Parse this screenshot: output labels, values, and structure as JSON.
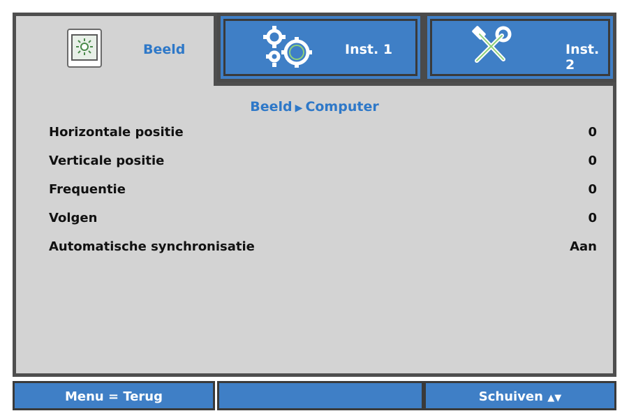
{
  "tabs": [
    {
      "label": "Beeld",
      "icon": "picture-icon",
      "active": true
    },
    {
      "label": "Inst. 1",
      "icon": "gears-icon",
      "active": false
    },
    {
      "label": "Inst. 2",
      "icon": "tools-icon",
      "active": false
    }
  ],
  "breadcrumb": {
    "parent": "Beeld",
    "separator": "▶",
    "current": "Computer"
  },
  "rows": [
    {
      "label": "Horizontale positie",
      "value": "0"
    },
    {
      "label": "Verticale positie",
      "value": "0"
    },
    {
      "label": "Frequentie",
      "value": "0"
    },
    {
      "label": "Volgen",
      "value": "0"
    },
    {
      "label": "Automatische synchronisatie",
      "value": "Aan"
    }
  ],
  "footer": {
    "left": "Menu = Terug",
    "middle": "",
    "right": "Schuiven",
    "right_arrows": "▲▼"
  },
  "colors": {
    "accent_blue": "#3f7fc6",
    "text_blue": "#2e78c8",
    "panel_gray": "#d3d3d3",
    "border_dark": "#4e4e4e"
  }
}
